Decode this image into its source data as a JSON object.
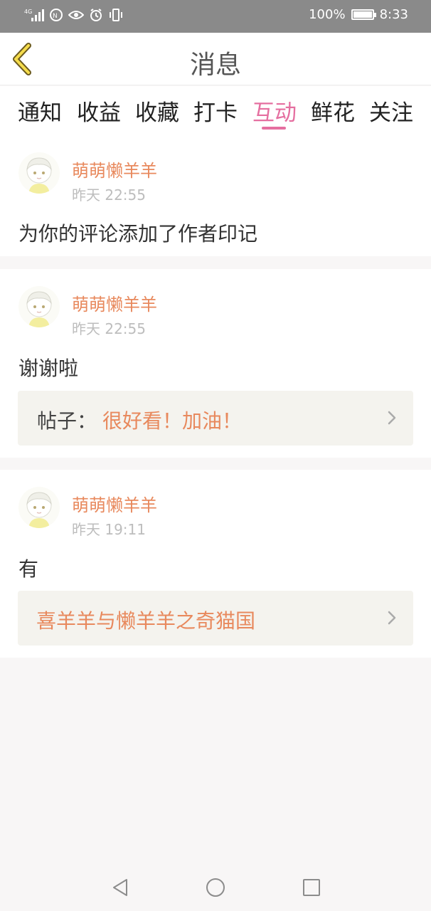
{
  "status_bar": {
    "battery_percent": "100%",
    "battery_level": 1.0,
    "time": "8:33",
    "icons": [
      "signal-icon",
      "nfc-icon",
      "eye-icon",
      "alarm-icon",
      "vibrate-icon",
      "battery-icon"
    ]
  },
  "header": {
    "title": "消息",
    "back_icon": "chevron-left-icon"
  },
  "tabs": [
    {
      "label": "通知",
      "active": false
    },
    {
      "label": "收益",
      "active": false
    },
    {
      "label": "收藏",
      "active": false
    },
    {
      "label": "打卡",
      "active": false
    },
    {
      "label": "互动",
      "active": true
    },
    {
      "label": "鲜花",
      "active": false
    },
    {
      "label": "关注",
      "active": false
    }
  ],
  "messages": [
    {
      "user": "萌萌懒羊羊",
      "time": "昨天 22:55",
      "text": "为你的评论添加了作者印记"
    },
    {
      "user": "萌萌懒羊羊",
      "time": "昨天 22:55",
      "text": "谢谢啦",
      "ref_label": "帖子：",
      "ref_text": "很好看！加油！"
    },
    {
      "user": "萌萌懒羊羊",
      "time": "昨天 19:11",
      "text": "有",
      "ref_text": "喜羊羊与懒羊羊之奇猫国"
    }
  ],
  "nav_bar": {
    "icons": [
      "back-triangle-icon",
      "home-circle-icon",
      "recents-square-icon"
    ]
  },
  "colors": {
    "accent": "#e56fa0",
    "username": "#e8895d",
    "status_bar": "#8a8a8a"
  }
}
